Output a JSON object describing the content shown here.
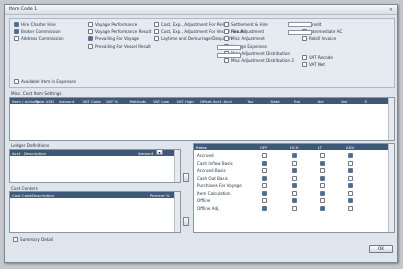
{
  "window": {
    "title": "Item Code 1",
    "close_glyph": "×"
  },
  "options": {
    "col1": [
      "Hire Charter Hire",
      "Broker Commission",
      "Address Commission"
    ],
    "col2": [
      "Voyage Performance",
      "Voyage Performance Result",
      "Prevailing For Voyage",
      "Prevailing For Vessel Result"
    ],
    "col3": [
      "Cost, Exp., Adjustment For Period",
      "Cost, Exp., Adjustment For Vessel Results",
      "Laytime and Demurrage/Despatch"
    ],
    "col4": [
      "Settlement & Hire",
      "Hire Adjustment",
      "Misc Adjustment",
      "Voyage Expenses",
      "Misc Adjustment Distribution",
      "Misc Adjustment Distribution 2"
    ],
    "col5": [
      "Credit",
      "Intermediate AC",
      "Rebill Invoice",
      "VAT Recode",
      "VAT Net"
    ],
    "available": "Available item in Expenses"
  },
  "main_grid": {
    "title": "Misc. Cost Item Settings",
    "columns": [
      "Item / Activity",
      "Rate USD",
      "Amount",
      "VAT Code",
      "VAT %",
      "Methods",
      "VAT Low",
      "VAT High",
      "Offset Acct",
      "Acct",
      "Tax",
      "Date",
      "Est",
      "Act",
      "Var",
      "S"
    ]
  },
  "ledger": {
    "title": "Ledger Definitions",
    "columns": [
      "Acct",
      "Description",
      "Amount"
    ],
    "dropdown_glyph": "▾"
  },
  "cost_centers": {
    "title": "Cost Centers",
    "columns": [
      "Cost Code",
      "Description",
      "Percent %"
    ]
  },
  "right_table": {
    "columns": [
      "Rates",
      "OFF",
      "HCH",
      "LT",
      "ADV"
    ],
    "rows": [
      {
        "name": "Accrued",
        "checks": [
          false,
          true,
          false,
          true
        ]
      },
      {
        "name": "Cash Inflow Basis",
        "checks": [
          true,
          false,
          true,
          false
        ]
      },
      {
        "name": "Accrued Basis",
        "checks": [
          false,
          true,
          false,
          true
        ]
      },
      {
        "name": "Cash Out Basis",
        "checks": [
          true,
          false,
          true,
          false
        ]
      },
      {
        "name": "Purchases For Voyage",
        "checks": [
          false,
          true,
          false,
          true
        ]
      },
      {
        "name": "Item Calculation",
        "checks": [
          true,
          false,
          true,
          false
        ]
      },
      {
        "name": "Offline",
        "checks": [
          false,
          true,
          false,
          true
        ]
      },
      {
        "name": "Offline Adj.",
        "checks": [
          true,
          false,
          true,
          false
        ]
      }
    ]
  },
  "footer": {
    "summary_label": "Summary Detail",
    "ok_label": "OK"
  }
}
